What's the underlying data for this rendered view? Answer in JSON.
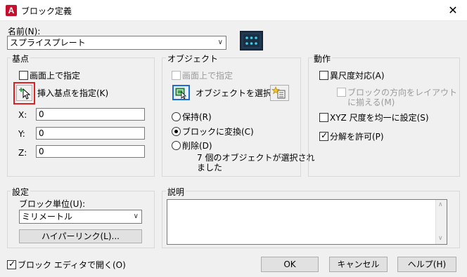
{
  "window": {
    "app_icon_letter": "A",
    "title": "ブロック定義",
    "close_glyph": "✕"
  },
  "name": {
    "label": "名前(N):",
    "value": "スプライスプレート"
  },
  "base_point": {
    "group_label": "基点",
    "specify_on_screen": "画面上で指定",
    "pick_button_label": "挿入基点を指定(K)",
    "x_label": "X:",
    "x_value": "0",
    "y_label": "Y:",
    "y_value": "0",
    "z_label": "Z:",
    "z_value": "0"
  },
  "objects": {
    "group_label": "オブジェクト",
    "specify_on_screen": "画面上で指定",
    "select_objects_label": "オブジェクトを選択(T)",
    "retain_label": "保持(R)",
    "convert_label": "ブロックに変換(C)",
    "delete_label": "削除(D)",
    "status_line1": "7 個のオブジェクトが選択され",
    "status_line2": "ました",
    "selected_option": "convert"
  },
  "behavior": {
    "group_label": "動作",
    "annotative_label": "異尺度対応(A)",
    "match_orientation_line1": "ブロックの方向をレイアウト",
    "match_orientation_line2": "に揃える(M)",
    "uniform_scale_label": "XYZ 尺度を均一に設定(S)",
    "allow_explode_label": "分解を許可(P)",
    "annotative_checked": false,
    "uniform_scale_checked": false,
    "allow_explode_checked": true
  },
  "settings": {
    "group_label": "設定",
    "unit_label": "ブロック単位(U):",
    "unit_value": "ミリメートル",
    "hyperlink_button": "ハイパーリンク(L)..."
  },
  "description": {
    "group_label": "説明",
    "value": ""
  },
  "footer": {
    "open_in_editor_label": "ブロック エディタで開く(O)",
    "open_in_editor_checked": true,
    "ok_label": "OK",
    "cancel_label": "キャンセル",
    "help_label": "ヘルプ(H)"
  },
  "colors": {
    "highlight_red": "#e02020",
    "accent_blue": "#1e6bd6",
    "preview_bg": "#1a2e44",
    "preview_dots": "#3fd0e8"
  }
}
